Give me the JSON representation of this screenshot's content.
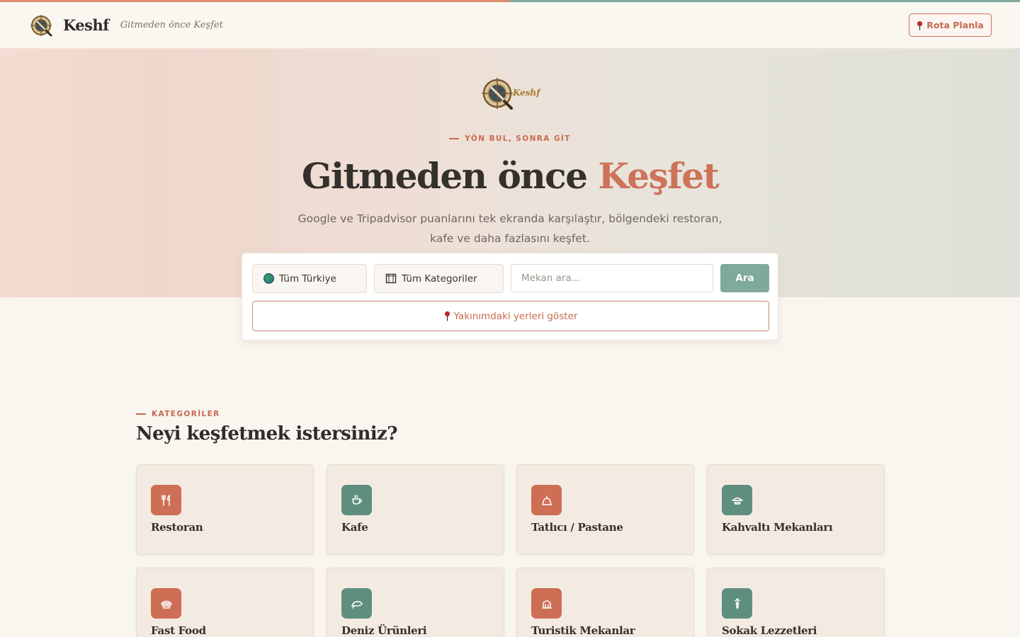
{
  "colors": {
    "accent": "#cd735a",
    "sage": "#7fa99d",
    "background": "#f9f5ef"
  },
  "header": {
    "brand_name": "Keshf",
    "tagline": "Gitmeden önce Keşfet",
    "route_button": "Rota Planla",
    "logo_icon": "compass-magnifier-icon"
  },
  "hero": {
    "emblem_text": "Keshf",
    "eyebrow": "YÖN BUL, SONRA GİT",
    "title_main": "Gitmeden önce",
    "title_accent": "Keşfet",
    "subtitle": "Google ve Tripadvisor puanlarını tek ekranda karşılaştır, bölgendeki restoran, kafe ve daha fazlasını keşfet."
  },
  "search": {
    "region_value": "Tüm Türkiye",
    "category_value": "Tüm Kategoriler",
    "placeholder": "Mekan ara...",
    "search_button": "Ara",
    "nearby_button": "Yakınımdaki yerleri göster"
  },
  "categories": {
    "eyebrow": "KATEGORİLER",
    "title": "Neyi keşfetmek istersiniz?",
    "items": [
      {
        "label": "Restoran",
        "icon": "fork-knife-icon",
        "tone": "terra"
      },
      {
        "label": "Kafe",
        "icon": "coffee-cup-icon",
        "tone": "sage"
      },
      {
        "label": "Tatlıcı / Pastane",
        "icon": "cake-icon",
        "tone": "terra"
      },
      {
        "label": "Kahvaltı Mekanları",
        "icon": "breakfast-bowl-icon",
        "tone": "sage"
      },
      {
        "label": "Fast Food",
        "icon": "burger-icon",
        "tone": "terra"
      },
      {
        "label": "Deniz Ürünleri",
        "icon": "fish-icon",
        "tone": "sage"
      },
      {
        "label": "Turistik Mekanlar",
        "icon": "landmark-icon",
        "tone": "terra"
      },
      {
        "label": "Sokak Lezzetleri",
        "icon": "street-food-icon",
        "tone": "sage"
      }
    ]
  }
}
